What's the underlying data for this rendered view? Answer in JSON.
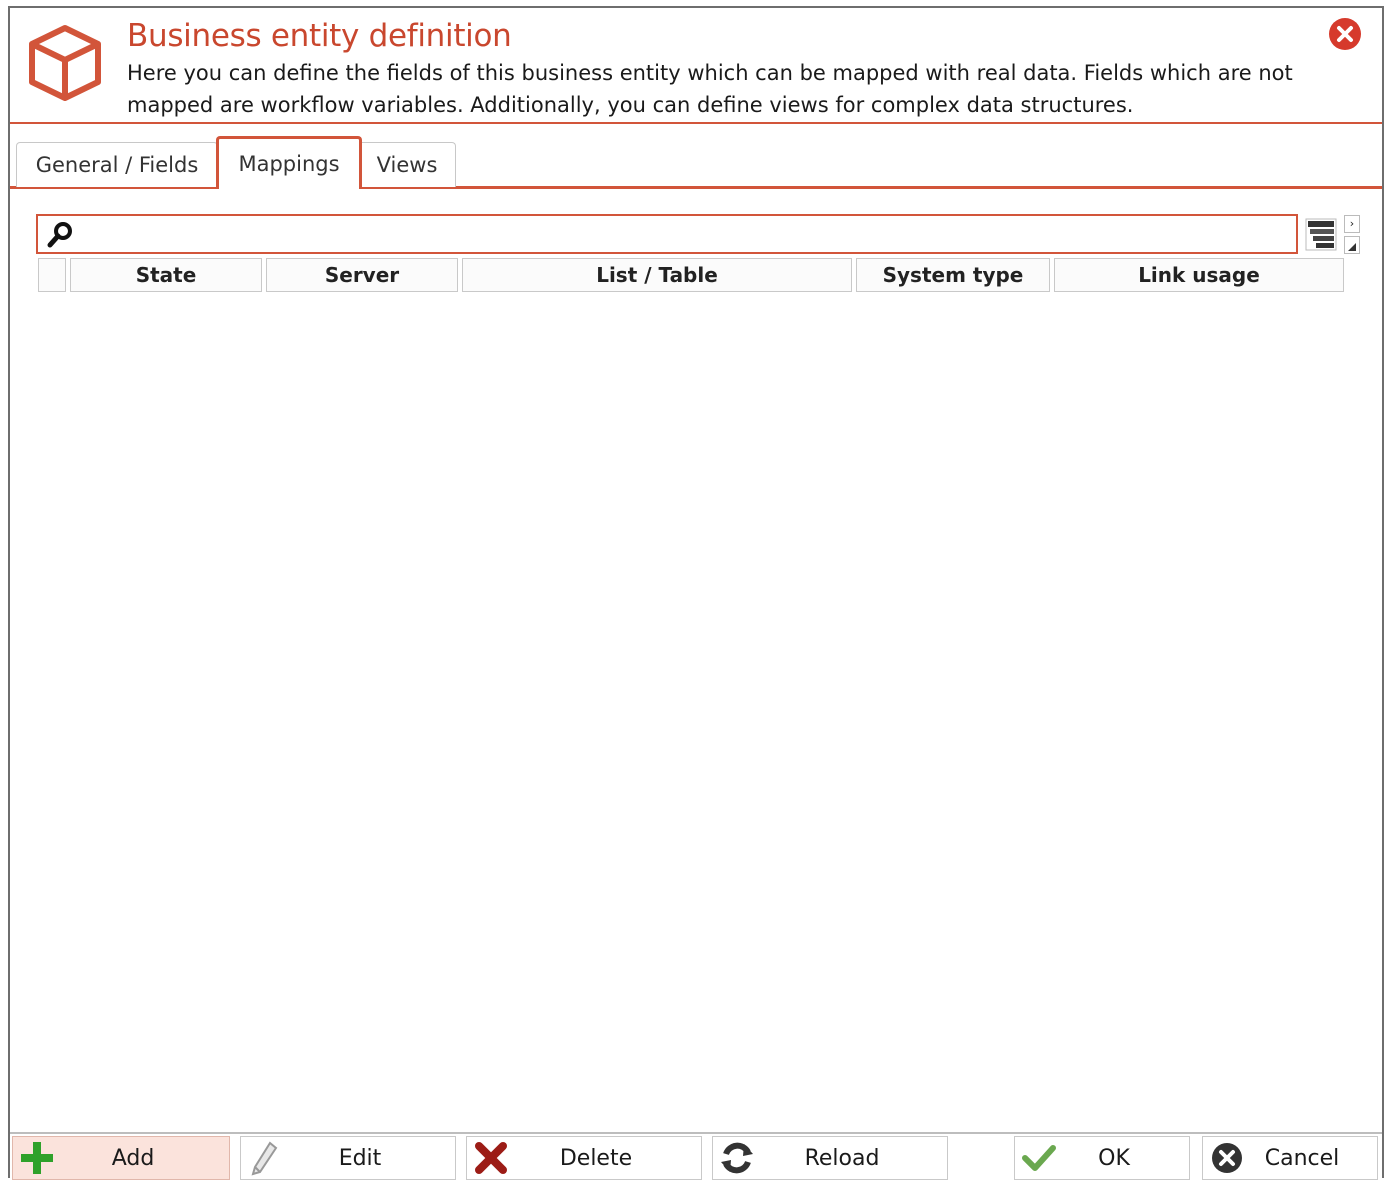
{
  "dialog": {
    "title": "Business entity definition",
    "description": "Here you can define the fields of this business entity which can be mapped with real data. Fields which are not mapped are workflow variables. Additionally, you can define views for complex data structures.",
    "accent_color": "#d2553a",
    "logo_icon": "cube-icon",
    "close_icon": "close-circle-icon"
  },
  "tabs": [
    {
      "label": "General / Fields",
      "active": false
    },
    {
      "label": "Mappings",
      "active": true
    },
    {
      "label": "Views",
      "active": false
    }
  ],
  "search": {
    "placeholder": "",
    "value": ""
  },
  "grid": {
    "columns": [
      "State",
      "Server",
      "List / Table",
      "System type",
      "Link usage"
    ],
    "rows": []
  },
  "toolbar": {
    "add": "Add",
    "edit": "Edit",
    "delete": "Delete",
    "reload": "Reload",
    "ok": "OK",
    "cancel": "Cancel"
  }
}
